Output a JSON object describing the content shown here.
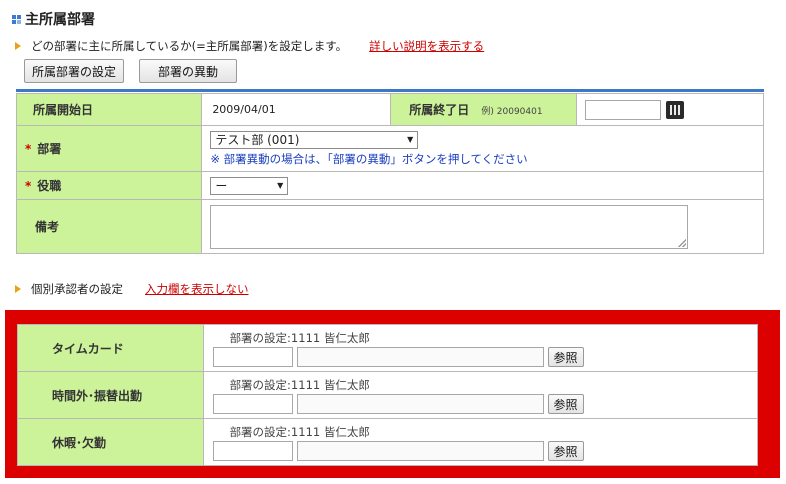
{
  "section": {
    "title": "主所属部署",
    "description": "どの部署に主に所属しているか(=主所属部署)を設定します。",
    "detail_link": "詳しい説明を表示する"
  },
  "buttons": {
    "dept_setting": "所属部署の設定",
    "dept_transfer": "部署の異動"
  },
  "form": {
    "start_label": "所属開始日",
    "start_value": "2009/04/01",
    "end_label": "所属終了日",
    "end_example": "例) 20090401",
    "end_value": "",
    "dept_label": "部署",
    "dept_value": "テスト部 (001)",
    "dept_note": "※ 部署異動の場合は、「部署の異動」ボタンを押してください",
    "position_label": "役職",
    "position_value": "ー",
    "remarks_label": "備考",
    "remarks_value": "",
    "required_mark": "*"
  },
  "approver": {
    "title": "個別承認者の設定",
    "hide_link": "入力欄を表示しない",
    "rows": [
      {
        "label": "タイムカード",
        "dept_setting": "部署の設定:1111 皆仁太郎",
        "ref_label": "参照"
      },
      {
        "label": "時間外･振替出勤",
        "dept_setting": "部署の設定:1111 皆仁太郎",
        "ref_label": "参照"
      },
      {
        "label": "休暇･欠勤",
        "dept_setting": "部署の設定:1111 皆仁太郎",
        "ref_label": "参照"
      }
    ]
  },
  "colors": {
    "label_bg": "#ccf29a",
    "accent_red": "#dd0000",
    "link_red": "#cc0000",
    "note_blue": "#1b3fbf",
    "rule_blue": "#3b78c8"
  },
  "icons": [
    "grid-squares-icon",
    "orange-triangle-icon",
    "calendar-icon",
    "dropdown-arrow-icon"
  ]
}
